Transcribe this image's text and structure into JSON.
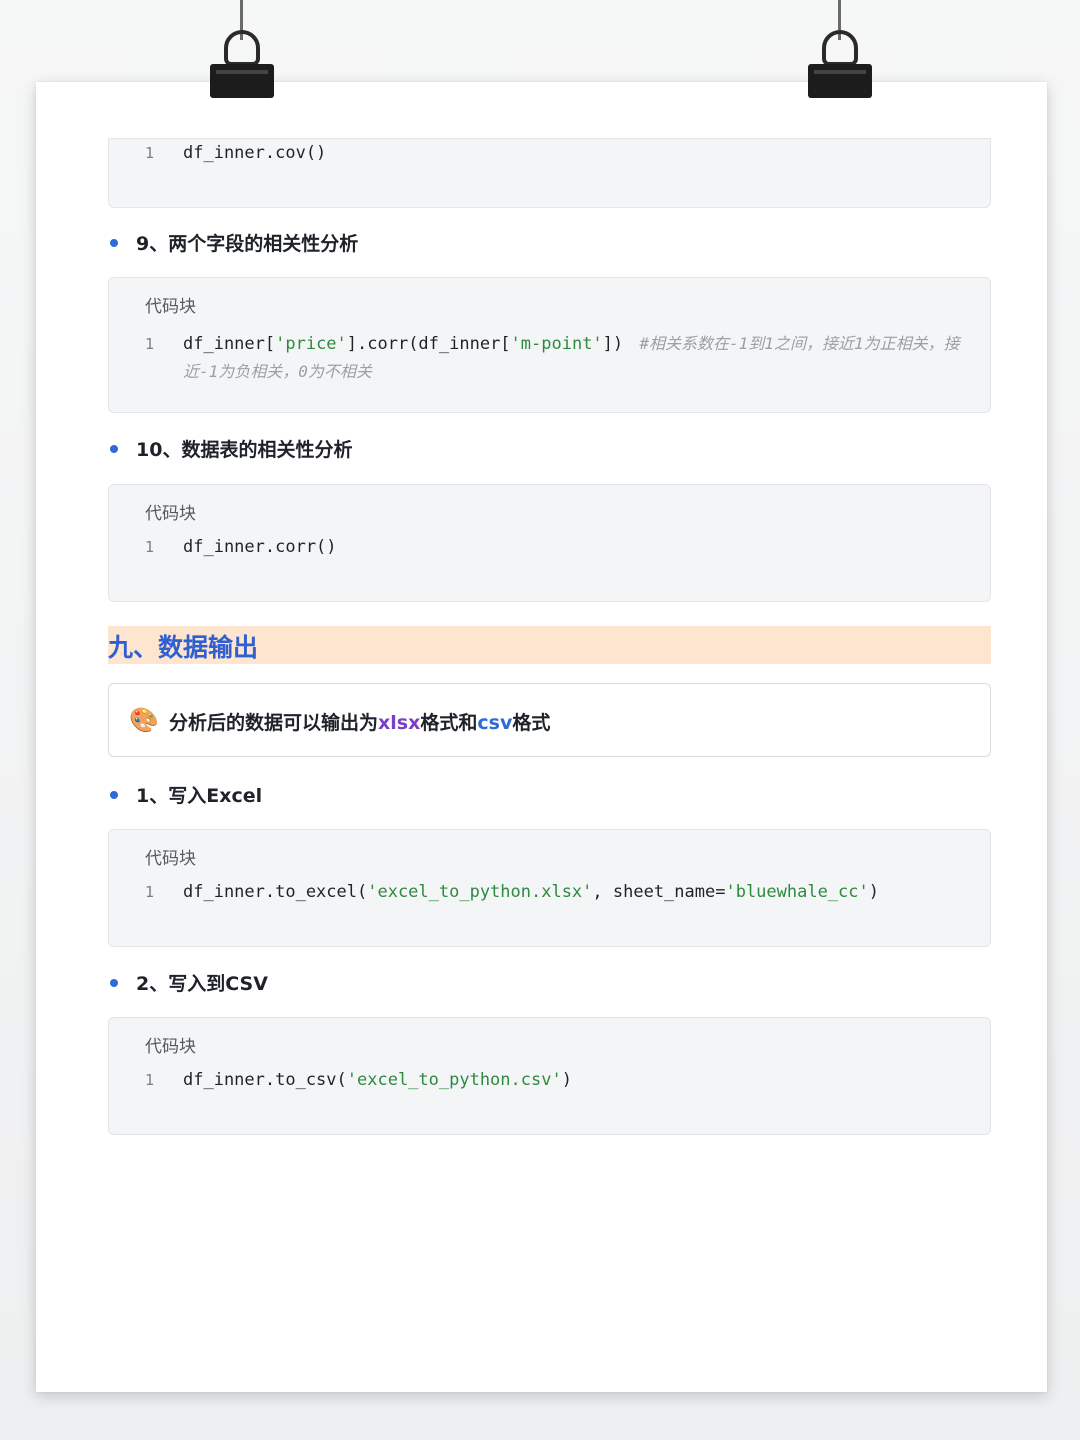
{
  "blocks": {
    "top": {
      "line_no": "1",
      "code": "df_inner.cov()"
    },
    "corr_pair": {
      "label": "代码块",
      "line_no": "1",
      "code_pre": "df_inner[",
      "str1": "'price'",
      "code_mid1": "].corr(df_inner[",
      "str2": "'m-point'",
      "code_mid2": "])",
      "comment_1": "#相关系数在-1到1之间，接近1为正相关，接",
      "comment_2": "近-1为负相关，0为不相关"
    },
    "corr_table": {
      "label": "代码块",
      "line_no": "1",
      "code": "df_inner.corr()"
    },
    "excel": {
      "label": "代码块",
      "line_no": "1",
      "code_pre": "df_inner.to_excel(",
      "str1": "'excel_to_python.xlsx'",
      "code_mid": ", sheet_name=",
      "str2": "'bluewhale_cc'",
      "code_post": ")"
    },
    "csv": {
      "label": "代码块",
      "line_no": "1",
      "code_pre": "df_inner.to_csv(",
      "str1": "'excel_to_python.csv'",
      "code_post": ")"
    }
  },
  "bullets": {
    "b9": "9、两个字段的相关性分析",
    "b10": "10、数据表的相关性分析",
    "b1": "1、写入Excel",
    "b2": "2、写入到CSV"
  },
  "section": {
    "title": "九、数据输出"
  },
  "callout": {
    "icon": "palette-icon",
    "text_pre": "分析后的数据可以输出为",
    "hl1": "xlsx",
    "text_mid": "格式和",
    "hl2": "csv",
    "text_post": "格式"
  }
}
